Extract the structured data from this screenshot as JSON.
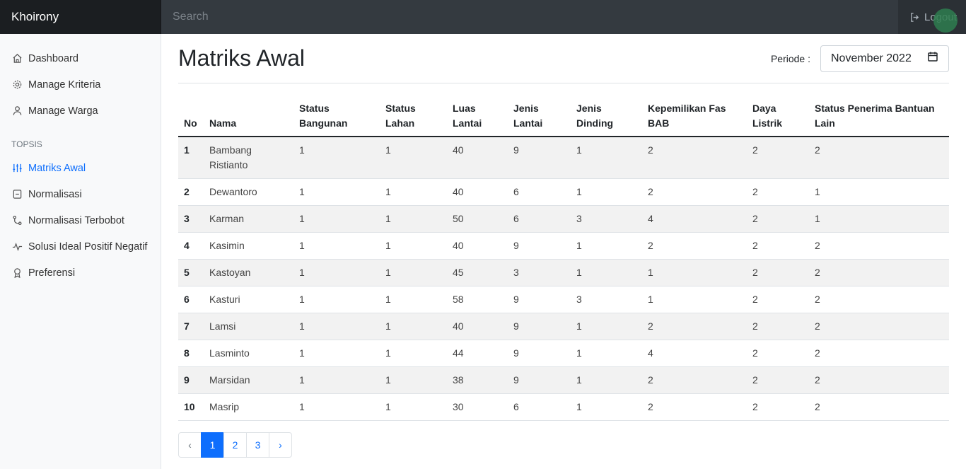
{
  "navbar": {
    "brand": "Khoirony",
    "search_placeholder": "Search",
    "logout_label": "Logout"
  },
  "sidebar": {
    "items": [
      {
        "label": "Dashboard",
        "icon": "home-icon"
      },
      {
        "label": "Manage Kriteria",
        "icon": "gear-icon"
      },
      {
        "label": "Manage Warga",
        "icon": "person-icon"
      }
    ],
    "section_heading": "TOPSIS",
    "topsis_items": [
      {
        "label": "Matriks Awal",
        "icon": "sliders-icon",
        "active": true
      },
      {
        "label": "Normalisasi",
        "icon": "file-minus-icon"
      },
      {
        "label": "Normalisasi Terbobot",
        "icon": "git-merge-icon"
      },
      {
        "label": "Solusi Ideal Positif Negatif",
        "icon": "activity-icon"
      },
      {
        "label": "Preferensi",
        "icon": "award-icon"
      }
    ]
  },
  "main": {
    "title": "Matriks Awal",
    "periode_label": "Periode :",
    "periode_value": "November 2022"
  },
  "table": {
    "headers": [
      "No",
      "Nama",
      "Status Bangunan",
      "Status Lahan",
      "Luas Lantai",
      "Jenis Lantai",
      "Jenis Dinding",
      "Kepemilikan Fas BAB",
      "Daya Listrik",
      "Status Penerima Bantuan Lain"
    ],
    "rows": [
      [
        "1",
        "Bambang Ristianto",
        "1",
        "1",
        "40",
        "9",
        "1",
        "2",
        "2",
        "2"
      ],
      [
        "2",
        "Dewantoro",
        "1",
        "1",
        "40",
        "6",
        "1",
        "2",
        "2",
        "1"
      ],
      [
        "3",
        "Karman",
        "1",
        "1",
        "50",
        "6",
        "3",
        "4",
        "2",
        "1"
      ],
      [
        "4",
        "Kasimin",
        "1",
        "1",
        "40",
        "9",
        "1",
        "2",
        "2",
        "2"
      ],
      [
        "5",
        "Kastoyan",
        "1",
        "1",
        "45",
        "3",
        "1",
        "1",
        "2",
        "2"
      ],
      [
        "6",
        "Kasturi",
        "1",
        "1",
        "58",
        "9",
        "3",
        "1",
        "2",
        "2"
      ],
      [
        "7",
        "Lamsi",
        "1",
        "1",
        "40",
        "9",
        "1",
        "2",
        "2",
        "2"
      ],
      [
        "8",
        "Lasminto",
        "1",
        "1",
        "44",
        "9",
        "1",
        "4",
        "2",
        "2"
      ],
      [
        "9",
        "Marsidan",
        "1",
        "1",
        "38",
        "9",
        "1",
        "2",
        "2",
        "2"
      ],
      [
        "10",
        "Masrip",
        "1",
        "1",
        "30",
        "6",
        "1",
        "2",
        "2",
        "2"
      ]
    ]
  },
  "pagination": {
    "prev": "‹",
    "pages": [
      "1",
      "2",
      "3"
    ],
    "active": "1",
    "next": "›"
  }
}
